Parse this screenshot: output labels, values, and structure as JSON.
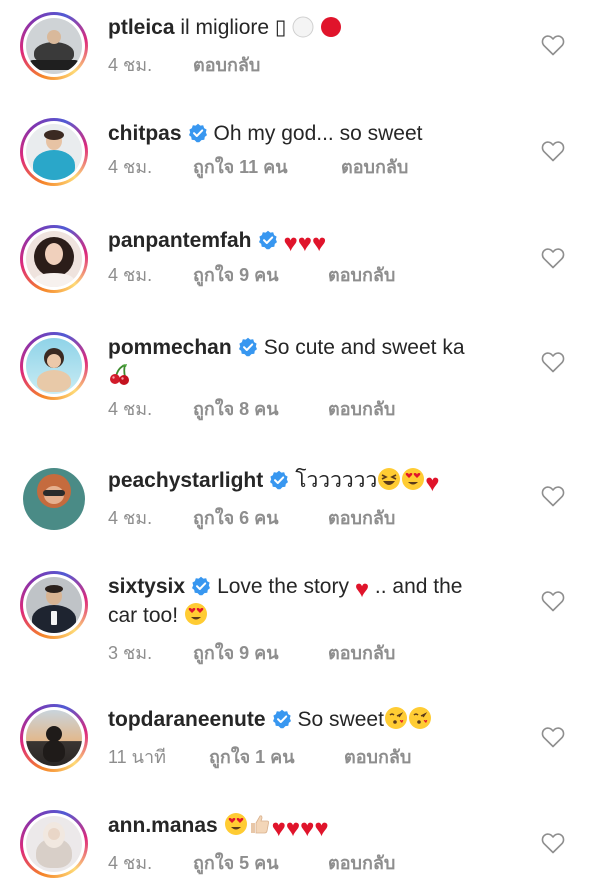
{
  "comments": [
    {
      "username": "ptleica",
      "verified": false,
      "text": "il migliore ▯",
      "time": "4 ชม.",
      "likes": "",
      "reply": "ตอบกลับ"
    },
    {
      "username": "chitpas",
      "verified": true,
      "text": "Oh my god... so sweet",
      "time": "4 ชม.",
      "likes": "ถูกใจ 11 คน",
      "reply": "ตอบกลับ"
    },
    {
      "username": "panpantemfah",
      "verified": true,
      "text": "",
      "time": "4 ชม.",
      "likes": "ถูกใจ 9 คน",
      "reply": "ตอบกลับ"
    },
    {
      "username": "pommechan",
      "verified": true,
      "text": "So cute and sweet ka",
      "time": "4 ชม.",
      "likes": "ถูกใจ 8 คน",
      "reply": "ตอบกลับ"
    },
    {
      "username": "peachystarlight",
      "verified": true,
      "text": "โวววววว",
      "time": "4 ชม.",
      "likes": "ถูกใจ 6 คน",
      "reply": "ตอบกลับ"
    },
    {
      "username": "sixtysix",
      "verified": true,
      "text": "Love the story",
      "text2": ".. and the",
      "text3": "car too!",
      "time": "3 ชม.",
      "likes": "ถูกใจ 9 คน",
      "reply": "ตอบกลับ"
    },
    {
      "username": "topdaraneenute",
      "verified": true,
      "text": "So sweet",
      "time": "11 นาที",
      "likes": "ถูกใจ 1 คน",
      "reply": "ตอบกลับ"
    },
    {
      "username": "ann.manas",
      "verified": false,
      "text": "",
      "time": "4 ชม.",
      "likes": "ถูกใจ 5 คน",
      "reply": "ตอบกลับ"
    }
  ],
  "icons": {
    "verified": "verified-badge-icon",
    "like": "heart-outline-icon"
  },
  "colors": {
    "verified_blue": "#3897f0",
    "meta_gray": "#8e8e8e",
    "heart_red": "#e0142b"
  }
}
